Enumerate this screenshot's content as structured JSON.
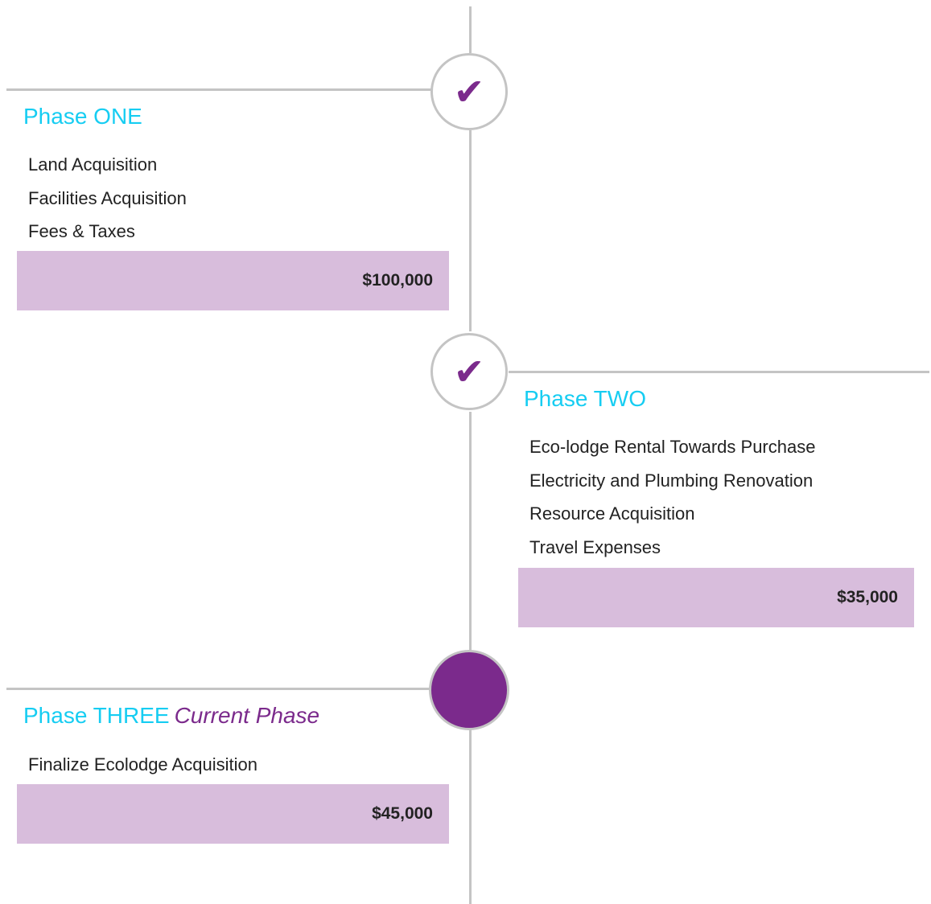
{
  "colors": {
    "accent": "#7b2a8c",
    "title": "#16cdf2",
    "line": "#c4c4c4",
    "amount_bg": "#d8bddc"
  },
  "phases": [
    {
      "title": "Phase ONE",
      "status_icon": "check-icon",
      "check": "✔",
      "items": [
        "Land Acquisition",
        "Facilities Acquisition",
        "Fees & Taxes"
      ],
      "amount": "$100,000"
    },
    {
      "title": "Phase TWO",
      "status_icon": "check-icon",
      "check": "✔",
      "items": [
        "Eco-lodge Rental Towards Purchase",
        "Electricity and Plumbing Renovation",
        "Resource Acquisition",
        "Travel Expenses"
      ],
      "amount": "$35,000"
    },
    {
      "title": "Phase THREE",
      "current_label": "Current Phase",
      "status_icon": "current-dot",
      "items": [
        "Finalize Ecolodge Acquisition"
      ],
      "amount": "$45,000"
    }
  ]
}
